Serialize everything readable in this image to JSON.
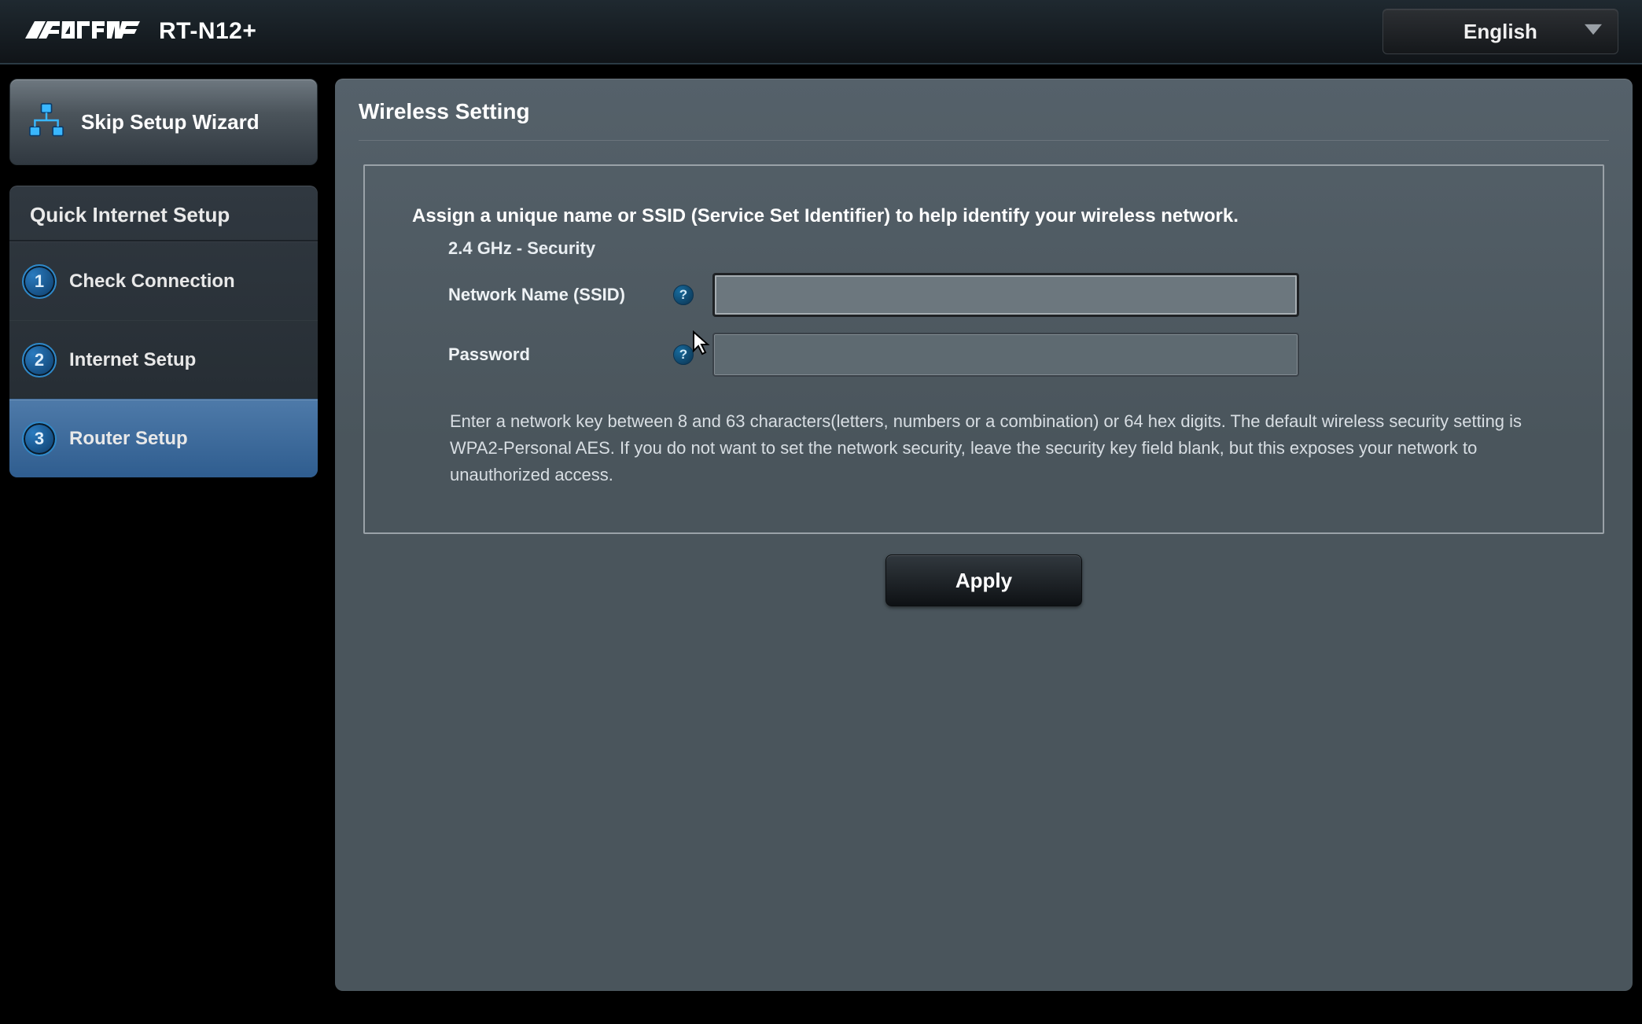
{
  "header": {
    "brand": "ASUS",
    "model": "RT-N12+",
    "language": "English"
  },
  "sidebar": {
    "skip_label": "Skip Setup Wizard",
    "panel_title": "Quick Internet Setup",
    "steps": [
      {
        "num": "1",
        "label": "Check Connection"
      },
      {
        "num": "2",
        "label": "Internet Setup"
      },
      {
        "num": "3",
        "label": "Router Setup"
      }
    ],
    "active_index": 2
  },
  "main": {
    "title": "Wireless Setting",
    "instruction": "Assign a unique name or SSID (Service Set Identifier) to help identify your wireless network.",
    "subhead": "2.4 GHz - Security",
    "ssid_label": "Network Name (SSID)",
    "ssid_value": "",
    "password_label": "Password",
    "password_value": "",
    "help_glyph": "?",
    "note": "Enter a network key between 8 and 63 characters(letters, numbers or a combination) or 64 hex digits. The default wireless security setting is WPA2-Personal AES. If you do not want to set the network security, leave the security key field blank, but this exposes your network to unauthorized access.",
    "apply_label": "Apply"
  }
}
